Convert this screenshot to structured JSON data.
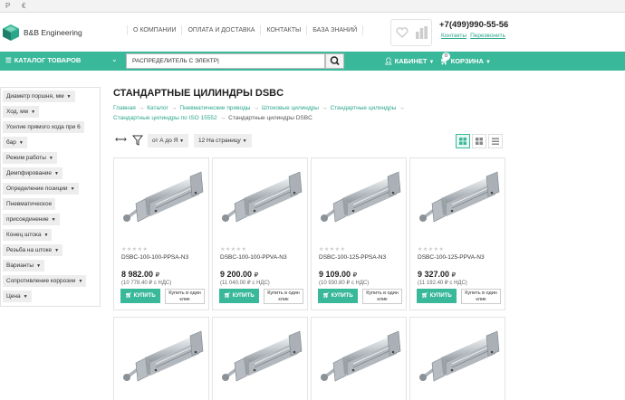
{
  "browser_strip": {
    "left_char": "P",
    "right_char": "€"
  },
  "header": {
    "logo_text": "B&B Engineering",
    "nav": [
      "О КОМПАНИИ",
      "ОПЛАТА И ДОСТАВКА",
      "КОНТАКТЫ",
      "БАЗА ЗНАНИЙ"
    ],
    "phone": "+7(499)990-55-56",
    "contacts_label": "Контакты",
    "callback_label": "Перезвонить"
  },
  "greenbar": {
    "catalog_label": "КАТАЛОГ ТОВАРОВ",
    "search_value": "РАСПРЕДЕЛИТЕЛЬ С ЭЛЕКТР|",
    "cabinet_label": "КАБИНЕТ",
    "cart_label": "КОРЗИНА",
    "cart_count": "0"
  },
  "filters": [
    "Диаметр поршня, мм",
    "Ход, мм",
    "Усилие прямого хода при 6",
    "бар",
    "Режим работы",
    "Демпфирование",
    "Определение позиции",
    "Пневматическое",
    "присоединение",
    "Конец штока",
    "Резьба на штоке",
    "Варианты",
    "Сопротивление коррозии",
    "Цена"
  ],
  "page": {
    "title": "СТАНДАРТНЫЕ ЦИЛИНДРЫ DSBC",
    "breadcrumbs": [
      "Главная",
      "Каталог",
      "Пневматические приводы",
      "Штоковые цилиндры",
      "Стандартные цилиндры",
      "Стандартные цилиндры по ISO 15552",
      "Стандартные цилиндры DSBC"
    ]
  },
  "toolbar": {
    "sort_label": "от А до Я",
    "perpage_label": "12 На страницу"
  },
  "products": [
    {
      "sku": "DSBC-100-100-PPSA-N3",
      "price": "8 982.00",
      "currency": "₽",
      "price_vat": "(10 778.40 ₽ с НДС)",
      "buy": "КУПИТЬ",
      "oneclick": "Купить в один клик"
    },
    {
      "sku": "DSBC-100-100-PPVA-N3",
      "price": "9 200.00",
      "currency": "₽",
      "price_vat": "(11 040.00 ₽ с НДС)",
      "buy": "КУПИТЬ",
      "oneclick": "Купить в один клик"
    },
    {
      "sku": "DSBC-100-125-PPSA-N3",
      "price": "9 109.00",
      "currency": "₽",
      "price_vat": "(10 930.80 ₽ с НДС)",
      "buy": "КУПИТЬ",
      "oneclick": "Купить в один клик"
    },
    {
      "sku": "DSBC-100-125-PPVA-N3",
      "price": "9 327.00",
      "currency": "₽",
      "price_vat": "(11 192.40 ₽ с НДС)",
      "buy": "КУПИТЬ",
      "oneclick": "Купить в один клик"
    }
  ],
  "colors": {
    "accent": "#3ab89a",
    "link": "#2aa68a"
  }
}
